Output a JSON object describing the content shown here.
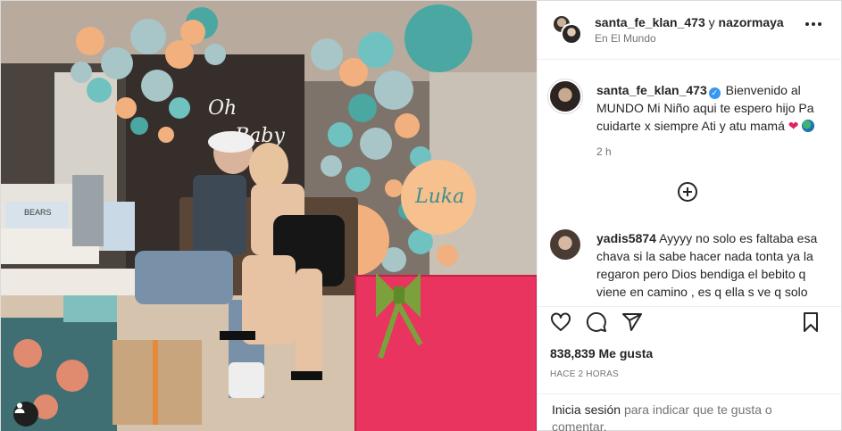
{
  "post": {
    "header": {
      "users": "santa_fe_klan_473",
      "joiner": "y",
      "collaborator": "nazormaya",
      "location": "En El Mundo"
    },
    "caption": {
      "username": "santa_fe_klan_473",
      "verified_mark": "✓",
      "text": "Bienvenido al MUNDO Mi Niño aqui te espero hijo Pa cuidarte x siempre Ati y atu mamá",
      "emoji_heart": "❤",
      "time": "2 h"
    },
    "comments": [
      {
        "username": "yadis5874",
        "text": "Ayyyy no solo es faltaba esa chava si la sabe hacer nada tonta ya la regaron pero Dios bendiga el bebito q viene en camino , es q ella s ve q solo"
      }
    ],
    "likes": "838,839 Me gusta",
    "posted": "HACE 2 HORAS",
    "login_prompt": {
      "link": "Inicia sesión",
      "rest": "para indicar que te gusta o comentar."
    },
    "photo_text": {
      "neon_sign": "Oh Baby",
      "balloon_name": "Luka",
      "bag_label": "BEARS"
    }
  },
  "icons": [
    "user-tag-icon",
    "more-options-icon",
    "verified-icon",
    "load-more-comments-icon",
    "heart-icon",
    "comment-icon",
    "share-icon",
    "bookmark-icon"
  ],
  "colors": {
    "text": "#262626",
    "secondary": "#737373",
    "border": "#dbdbdb",
    "verified": "#3897f0",
    "gift_pink": "#e8345e",
    "balloon_teal": "#4aa7a2",
    "balloon_peach": "#f2b07e"
  }
}
